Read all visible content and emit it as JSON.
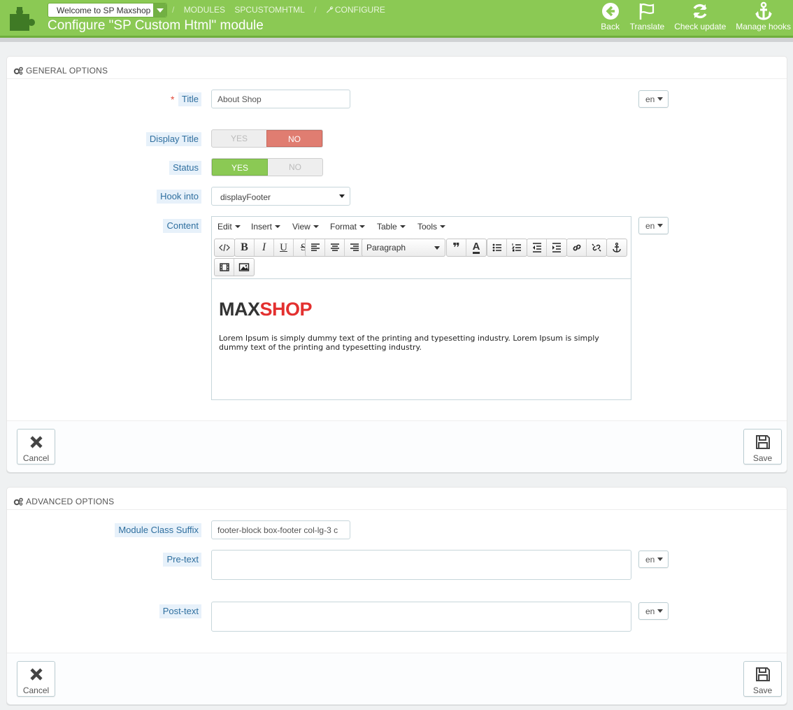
{
  "header": {
    "shop_name": "Welcome to SP Maxshop",
    "breadcrumb": [
      "MODULES",
      "SPCUSTOMHTML",
      "CONFIGURE"
    ],
    "breadcrumb_sep": "/",
    "title": "Configure \"SP Custom Html\" module",
    "toolbar": [
      {
        "label": "Back",
        "icon": "back-circle-icon"
      },
      {
        "label": "Translate",
        "icon": "flag-icon"
      },
      {
        "label": "Check update",
        "icon": "refresh-icon"
      },
      {
        "label": "Manage hooks",
        "icon": "anchor-icon"
      }
    ],
    "colors": {
      "bar": "#8bc954"
    }
  },
  "general": {
    "heading": "GENERAL OPTIONS",
    "title_label": "Title",
    "title_value": "About Shop",
    "lang": "en",
    "display_title_label": "Display Title",
    "status_label": "Status",
    "yes": "YES",
    "no": "NO",
    "hook_label": "Hook into",
    "hook_value": "displayFooter",
    "content_label": "Content",
    "editor_menu": [
      "Edit",
      "Insert",
      "View",
      "Format",
      "Table",
      "Tools"
    ],
    "format_select": "Paragraph",
    "brand_a": "MAX",
    "brand_b": "SHOP",
    "content_text": "Lorem Ipsum is simply dummy text of the printing and typesetting industry. Lorem Ipsum is simply dummy text of the printing and typesetting industry.",
    "cancel": "Cancel",
    "save": "Save"
  },
  "advanced": {
    "heading": "ADVANCED OPTIONS",
    "suffix_label": "Module Class Suffix",
    "suffix_value": "footer-block box-footer  col-lg-3 c",
    "pretext_label": "Pre-text",
    "posttext_label": "Post-text",
    "lang": "en",
    "cancel": "Cancel",
    "save": "Save"
  }
}
